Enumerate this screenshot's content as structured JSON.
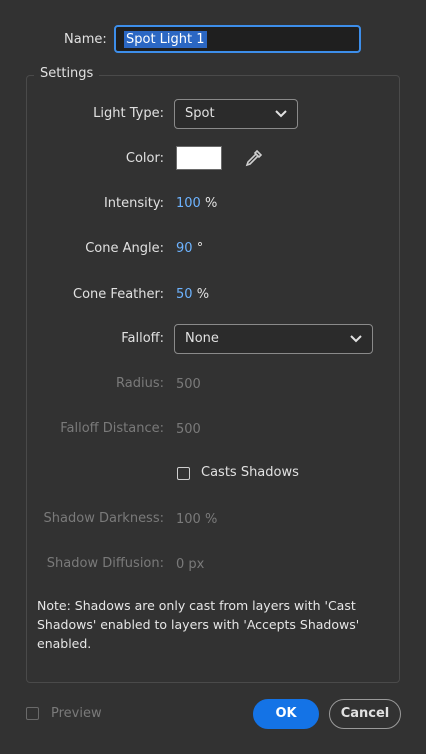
{
  "name": {
    "label": "Name:",
    "value": "Spot Light 1"
  },
  "settings": {
    "title": "Settings",
    "light_type": {
      "label": "Light Type:",
      "value": "Spot"
    },
    "color": {
      "label": "Color:",
      "swatch": "#ffffff"
    },
    "intensity": {
      "label": "Intensity:",
      "value": "100",
      "unit": "%"
    },
    "cone_angle": {
      "label": "Cone Angle:",
      "value": "90",
      "unit": "°"
    },
    "cone_feather": {
      "label": "Cone Feather:",
      "value": "50",
      "unit": "%"
    },
    "falloff": {
      "label": "Falloff:",
      "value": "None"
    },
    "radius": {
      "label": "Radius:",
      "value": "500"
    },
    "falloff_distance": {
      "label": "Falloff Distance:",
      "value": "500"
    },
    "casts_shadows": {
      "label": "Casts Shadows",
      "checked": false
    },
    "shadow_darkness": {
      "label": "Shadow Darkness:",
      "value": "100 %"
    },
    "shadow_diffusion": {
      "label": "Shadow Diffusion:",
      "value": "0 px"
    },
    "note": "Note: Shadows are only cast from layers with 'Cast Shadows' enabled to layers with 'Accepts Shadows' enabled."
  },
  "footer": {
    "preview": {
      "label": "Preview",
      "checked": false
    },
    "ok_label": "OK",
    "cancel_label": "Cancel"
  },
  "colors": {
    "accent": "#1473e6",
    "number": "#6db3ff",
    "background": "#323232"
  }
}
